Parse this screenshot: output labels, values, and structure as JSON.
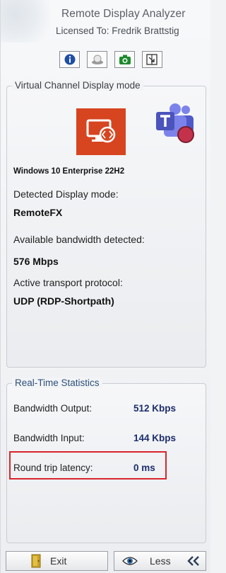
{
  "app": {
    "title": "Remote Display Analyzer",
    "license": "Licensed To: Fredrik Brattstig"
  },
  "toolbar": {
    "buttons": [
      {
        "icon": "info-icon",
        "color": "#1f4fa3"
      },
      {
        "icon": "disc-icon",
        "color": "#8a8a8a"
      },
      {
        "icon": "camera-icon",
        "color": "#1e8a2e"
      },
      {
        "icon": "window-arrow-icon",
        "color": "#333333"
      }
    ]
  },
  "display_mode": {
    "legend": "Virtual Channel Display mode",
    "os_name": "Windows 10 Enterprise 22H2",
    "detected_mode_label": "Detected Display mode:",
    "detected_mode_value": "RemoteFX",
    "bandwidth_label": "Available bandwidth detected:",
    "bandwidth_value": "576 Mbps",
    "transport_label": "Active transport protocol:",
    "transport_value": "UDP (RDP-Shortpath)",
    "icons": [
      {
        "icon": "remote-desktop-logo-icon",
        "color": "#d64520"
      },
      {
        "icon": "teams-logo-icon",
        "color": "#5059c9"
      }
    ]
  },
  "stats": {
    "legend": "Real-Time Statistics",
    "rows": [
      {
        "label": "Bandwidth Output:",
        "value": "512 Kbps"
      },
      {
        "label": "Bandwidth Input:",
        "value": "144 Kbps"
      },
      {
        "label": "Round trip latency:",
        "value": "0 ms"
      }
    ],
    "highlight_color": "#d8262b"
  },
  "footer": {
    "exit_label": "Exit",
    "less_label": "Less"
  }
}
